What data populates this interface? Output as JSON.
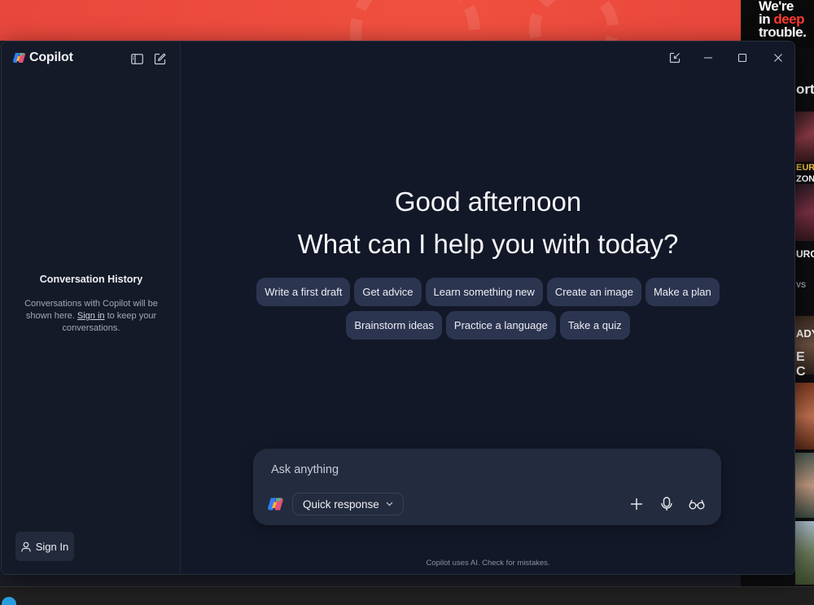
{
  "background": {
    "promo_lines": [
      "We're",
      "in ",
      "deep",
      "trouble."
    ],
    "sidebar_heading_fragment": "orts",
    "thumb_tags": [
      "EURO",
      "ZON",
      "URO",
      "VS",
      "ADYS",
      "E C"
    ]
  },
  "app": {
    "name": "Copilot",
    "sidebar": {
      "history_title": "Conversation History",
      "history_desc_before": "Conversations with Copilot will be shown here. ",
      "history_desc_link": "Sign in",
      "history_desc_after": " to keep your conversations.",
      "signin_label": "Sign In"
    },
    "main": {
      "greeting": "Good afternoon",
      "question": "What can I help you with today?",
      "chips_row1": [
        "Write a first draft",
        "Get advice",
        "Learn something new",
        "Create an image",
        "Make a plan"
      ],
      "chips_row2": [
        "Brainstorm ideas",
        "Practice a language",
        "Take a quiz"
      ],
      "composer": {
        "placeholder": "Ask anything",
        "mode_label": "Quick response"
      },
      "disclaimer": "Copilot uses AI. Check for mistakes."
    }
  },
  "colors": {
    "accent_red": "#f0503f",
    "window_bg": "#131828",
    "chip_bg": "#2c3550"
  }
}
